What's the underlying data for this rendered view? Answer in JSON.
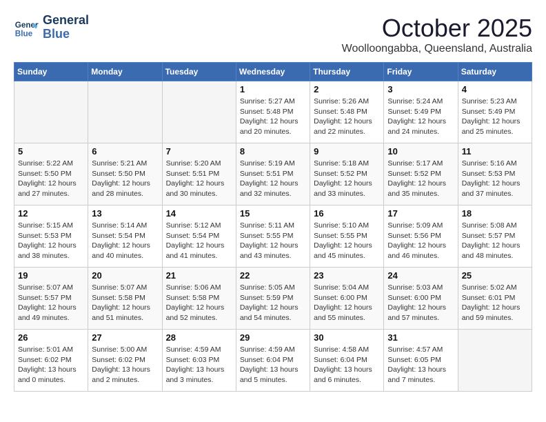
{
  "header": {
    "logo_line1": "General",
    "logo_line2": "Blue",
    "month_title": "October 2025",
    "location": "Woolloongabba, Queensland, Australia"
  },
  "weekdays": [
    "Sunday",
    "Monday",
    "Tuesday",
    "Wednesday",
    "Thursday",
    "Friday",
    "Saturday"
  ],
  "weeks": [
    [
      {
        "day": "",
        "info": ""
      },
      {
        "day": "",
        "info": ""
      },
      {
        "day": "",
        "info": ""
      },
      {
        "day": "1",
        "info": "Sunrise: 5:27 AM\nSunset: 5:48 PM\nDaylight: 12 hours\nand 20 minutes."
      },
      {
        "day": "2",
        "info": "Sunrise: 5:26 AM\nSunset: 5:48 PM\nDaylight: 12 hours\nand 22 minutes."
      },
      {
        "day": "3",
        "info": "Sunrise: 5:24 AM\nSunset: 5:49 PM\nDaylight: 12 hours\nand 24 minutes."
      },
      {
        "day": "4",
        "info": "Sunrise: 5:23 AM\nSunset: 5:49 PM\nDaylight: 12 hours\nand 25 minutes."
      }
    ],
    [
      {
        "day": "5",
        "info": "Sunrise: 5:22 AM\nSunset: 5:50 PM\nDaylight: 12 hours\nand 27 minutes."
      },
      {
        "day": "6",
        "info": "Sunrise: 5:21 AM\nSunset: 5:50 PM\nDaylight: 12 hours\nand 28 minutes."
      },
      {
        "day": "7",
        "info": "Sunrise: 5:20 AM\nSunset: 5:51 PM\nDaylight: 12 hours\nand 30 minutes."
      },
      {
        "day": "8",
        "info": "Sunrise: 5:19 AM\nSunset: 5:51 PM\nDaylight: 12 hours\nand 32 minutes."
      },
      {
        "day": "9",
        "info": "Sunrise: 5:18 AM\nSunset: 5:52 PM\nDaylight: 12 hours\nand 33 minutes."
      },
      {
        "day": "10",
        "info": "Sunrise: 5:17 AM\nSunset: 5:52 PM\nDaylight: 12 hours\nand 35 minutes."
      },
      {
        "day": "11",
        "info": "Sunrise: 5:16 AM\nSunset: 5:53 PM\nDaylight: 12 hours\nand 37 minutes."
      }
    ],
    [
      {
        "day": "12",
        "info": "Sunrise: 5:15 AM\nSunset: 5:53 PM\nDaylight: 12 hours\nand 38 minutes."
      },
      {
        "day": "13",
        "info": "Sunrise: 5:14 AM\nSunset: 5:54 PM\nDaylight: 12 hours\nand 40 minutes."
      },
      {
        "day": "14",
        "info": "Sunrise: 5:12 AM\nSunset: 5:54 PM\nDaylight: 12 hours\nand 41 minutes."
      },
      {
        "day": "15",
        "info": "Sunrise: 5:11 AM\nSunset: 5:55 PM\nDaylight: 12 hours\nand 43 minutes."
      },
      {
        "day": "16",
        "info": "Sunrise: 5:10 AM\nSunset: 5:55 PM\nDaylight: 12 hours\nand 45 minutes."
      },
      {
        "day": "17",
        "info": "Sunrise: 5:09 AM\nSunset: 5:56 PM\nDaylight: 12 hours\nand 46 minutes."
      },
      {
        "day": "18",
        "info": "Sunrise: 5:08 AM\nSunset: 5:57 PM\nDaylight: 12 hours\nand 48 minutes."
      }
    ],
    [
      {
        "day": "19",
        "info": "Sunrise: 5:07 AM\nSunset: 5:57 PM\nDaylight: 12 hours\nand 49 minutes."
      },
      {
        "day": "20",
        "info": "Sunrise: 5:07 AM\nSunset: 5:58 PM\nDaylight: 12 hours\nand 51 minutes."
      },
      {
        "day": "21",
        "info": "Sunrise: 5:06 AM\nSunset: 5:58 PM\nDaylight: 12 hours\nand 52 minutes."
      },
      {
        "day": "22",
        "info": "Sunrise: 5:05 AM\nSunset: 5:59 PM\nDaylight: 12 hours\nand 54 minutes."
      },
      {
        "day": "23",
        "info": "Sunrise: 5:04 AM\nSunset: 6:00 PM\nDaylight: 12 hours\nand 55 minutes."
      },
      {
        "day": "24",
        "info": "Sunrise: 5:03 AM\nSunset: 6:00 PM\nDaylight: 12 hours\nand 57 minutes."
      },
      {
        "day": "25",
        "info": "Sunrise: 5:02 AM\nSunset: 6:01 PM\nDaylight: 12 hours\nand 59 minutes."
      }
    ],
    [
      {
        "day": "26",
        "info": "Sunrise: 5:01 AM\nSunset: 6:02 PM\nDaylight: 13 hours\nand 0 minutes."
      },
      {
        "day": "27",
        "info": "Sunrise: 5:00 AM\nSunset: 6:02 PM\nDaylight: 13 hours\nand 2 minutes."
      },
      {
        "day": "28",
        "info": "Sunrise: 4:59 AM\nSunset: 6:03 PM\nDaylight: 13 hours\nand 3 minutes."
      },
      {
        "day": "29",
        "info": "Sunrise: 4:59 AM\nSunset: 6:04 PM\nDaylight: 13 hours\nand 5 minutes."
      },
      {
        "day": "30",
        "info": "Sunrise: 4:58 AM\nSunset: 6:04 PM\nDaylight: 13 hours\nand 6 minutes."
      },
      {
        "day": "31",
        "info": "Sunrise: 4:57 AM\nSunset: 6:05 PM\nDaylight: 13 hours\nand 7 minutes."
      },
      {
        "day": "",
        "info": ""
      }
    ]
  ]
}
